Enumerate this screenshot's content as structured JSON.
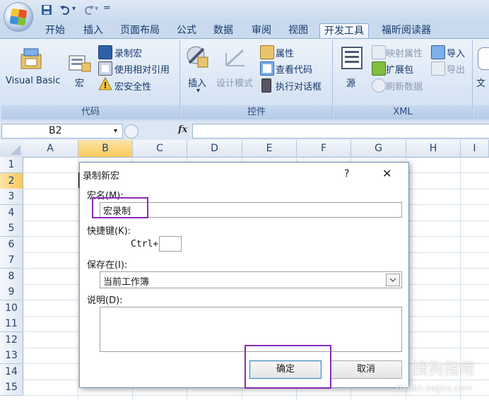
{
  "qat": {
    "dropdown_glyph": "▾",
    "separator": "="
  },
  "tabs": [
    "开始",
    "插入",
    "页面布局",
    "公式",
    "数据",
    "审阅",
    "视图",
    "开发工具",
    "福昕阅读器"
  ],
  "active_tab": "开发工具",
  "ribbon": {
    "code": {
      "visual_basic": "Visual Basic",
      "macros": "宏",
      "record_macro": "录制宏",
      "relative_ref": "使用相对引用",
      "macro_security": "宏安全性",
      "label": "代码"
    },
    "controls": {
      "insert": "插入",
      "design_mode": "设计模式",
      "properties": "属性",
      "view_code": "查看代码",
      "run_dialog": "执行对话框",
      "label": "控件"
    },
    "xml": {
      "source": "源",
      "map_properties": "映射属性",
      "expansion_packs": "扩展包",
      "refresh_data": "刷新数据",
      "import": "导入",
      "export": "导出",
      "label": "XML"
    },
    "doc_panel_partial": "文"
  },
  "formula_bar": {
    "cell_ref": "B2",
    "fx": "fx",
    "value": ""
  },
  "columns": [
    "A",
    "B",
    "C",
    "D",
    "E",
    "F",
    "G",
    "H",
    "I"
  ],
  "rows": [
    "1",
    "2",
    "3",
    "4",
    "5",
    "6",
    "7",
    "8",
    "9",
    "10",
    "11",
    "12",
    "13",
    "14",
    "15"
  ],
  "dialog": {
    "title": "录制新宏",
    "help": "?",
    "close": "✕",
    "macro_name_label": "宏名(M):",
    "macro_name_value": "宏录制",
    "shortcut_label": "快捷键(K):",
    "ctrl_prefix": "Ctrl+",
    "shortcut_value": "",
    "store_in_label": "保存在(I):",
    "store_in_value": "当前工作簿",
    "description_label": "说明(D):",
    "description_value": "",
    "ok": "确定",
    "cancel": "取消"
  },
  "watermark": {
    "text": "搜狗指南",
    "url": "zhinan.sogou.com"
  },
  "colors": {
    "highlight": "#8a2bb5",
    "ribbon": "#dae6f5",
    "selected_header": "#f9c95a"
  }
}
